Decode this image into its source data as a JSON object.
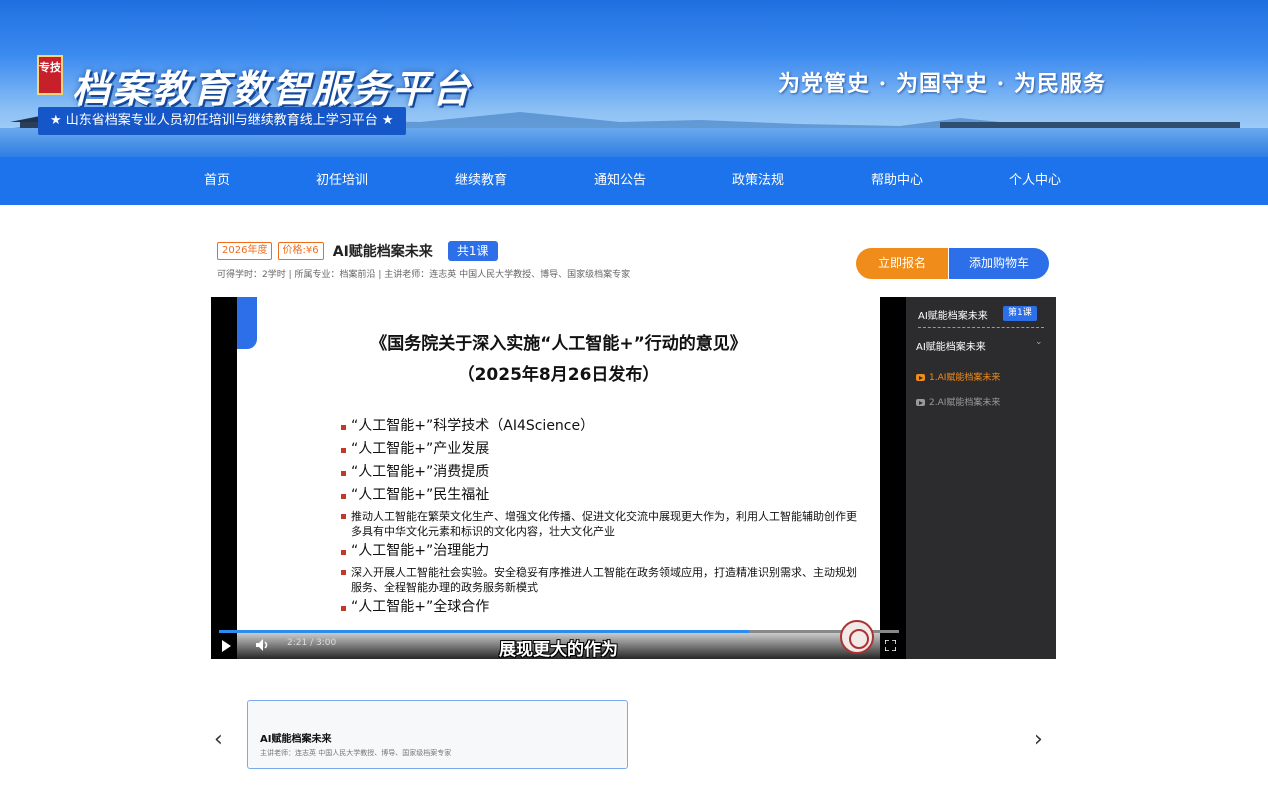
{
  "header": {
    "logo_badge": "专技",
    "site_title": "档案教育数智服务平台",
    "subtitle": "★ 山东省档案专业人员初任培训与继续教育线上学习平台 ★",
    "slogan": "为党管史 · 为国守史 · 为民服务"
  },
  "nav": [
    "首页",
    "初任培训",
    "继续教育",
    "通知公告",
    "政策法规",
    "帮助中心",
    "个人中心"
  ],
  "course": {
    "year_tag": "2026年度",
    "price_tag": "价格:¥6",
    "title": "AI赋能档案未来",
    "count_badge": "共1课",
    "meta": "可得学时：2学时 | 所属专业：档案前沿 | 主讲老师：连志英 中国人民大学教授、博导、国家级档案专家",
    "enroll_label": "立即报名",
    "cart_label": "添加购物车"
  },
  "player": {
    "slide_title": "《国务院关于深入实施“人工智能+”行动的意见》",
    "slide_date": "（2025年8月26日发布）",
    "items": [
      {
        "text": "“人工智能+”科学技术（AI4Science）",
        "size": "big"
      },
      {
        "text": "“人工智能+”产业发展",
        "size": "big"
      },
      {
        "text": "“人工智能+”消费提质",
        "size": "big"
      },
      {
        "text": "“人工智能+”民生福祉",
        "size": "big"
      },
      {
        "text": "推动人工智能在繁荣文化生产、增强文化传播、促进文化交流中展现更大作为，利用人工智能辅助创作更多具有中华文化元素和标识的文化内容，壮大文化产业",
        "size": "small"
      },
      {
        "text": "“人工智能+”治理能力",
        "size": "big"
      },
      {
        "text": "深入开展人工智能社会实验。安全稳妥有序推进人工智能在政务领域应用，打造精准识别需求、主动规划服务、全程智能办理的政务服务新模式",
        "size": "small"
      },
      {
        "text": "“人工智能+”全球合作",
        "size": "big"
      }
    ],
    "time": "2:21 / 3:00",
    "progress": 0.78,
    "subtitle": "展现更大的作为",
    "icons": {
      "play": "play-icon",
      "volume": "volume-icon",
      "fullscreen": "fullscreen-icon"
    }
  },
  "playlist": {
    "title": "AI赋能档案未来",
    "badge": "第1课",
    "section": "AI赋能档案未来",
    "items": [
      {
        "label": "1.AI赋能档案未来",
        "active": true
      },
      {
        "label": "2.AI赋能档案未来",
        "active": false
      }
    ],
    "colors": {
      "active": "#f08c1a",
      "inactive": "#9a9a9a"
    }
  },
  "carousel": {
    "prev": "‹",
    "next": "›",
    "card_title": "AI赋能档案未来",
    "card_sub": "主讲老师：连志英 中国人民大学教授、博导、国家级档案专家"
  },
  "colors": {
    "brand_blue": "#1c73eb",
    "accent_orange": "#f08c1a"
  }
}
